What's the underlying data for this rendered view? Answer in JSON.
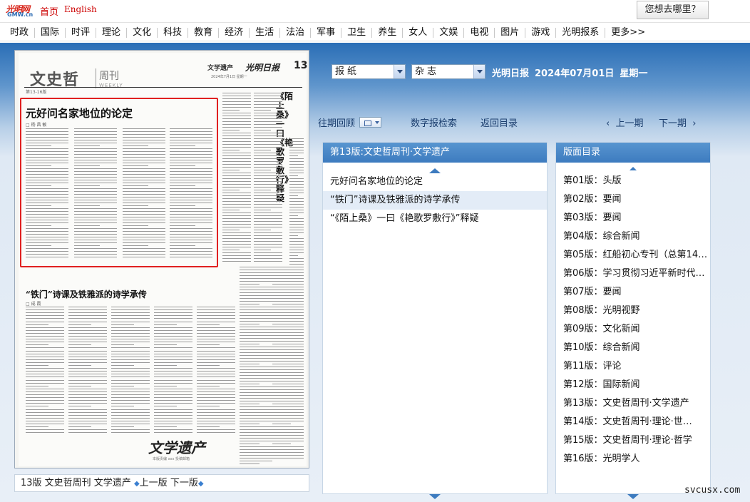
{
  "topbar": {
    "logo_cn": "光明网",
    "logo_en": "GMW.cn",
    "home": "首页",
    "english": "English",
    "where_button": "您想去哪里？"
  },
  "nav": [
    "时政",
    "国际",
    "时评",
    "理论",
    "文化",
    "科技",
    "教育",
    "经济",
    "生活",
    "法治",
    "军事",
    "卫生",
    "养生",
    "女人",
    "文娱",
    "电视",
    "图片",
    "游戏",
    "光明报系",
    "更多>>"
  ],
  "newspaper": {
    "header_title": "文史哲",
    "header_weekly": "周刊",
    "header_weekly_en": "WEEKLY",
    "section": "文学遗产",
    "brand": "光明日报",
    "page_number": "13",
    "date_line": "2024年7月1日 星期一",
    "page_range": "第13-16版",
    "article1_title": "元好问名家地位的论定",
    "article1_author": "□ 杨 昌 敏",
    "article2_title": "“铁门”诗课及铁雅派的诗学承传",
    "article2_author": "□ 成 霞",
    "article3_title": "《陌上桑》一曰《艳歌罗敷行》释疑",
    "stamp": "文学遗产",
    "stamp_sub": "本版责编 xxx 投稿邮箱"
  },
  "caption": {
    "page_label": "13版 文史哲周刊 文学遗产",
    "prev": "上一版",
    "next": "下一版"
  },
  "selectors": {
    "paper": "报纸",
    "magazine": "杂志"
  },
  "issue": {
    "paper_name": "光明日报",
    "date": "2024年07月01日",
    "weekday": "星期一"
  },
  "toolbar": {
    "past": "往期回顾",
    "search": "数字报检索",
    "back": "返回目录",
    "prev_issue": "上一期",
    "next_issue": "下一期"
  },
  "articles_panel": {
    "title": "第13版:文史哲周刊·文学遗产",
    "items": [
      "元好问名家地位的论定",
      "“铁门”诗课及铁雅派的诗学承传",
      "“《陌上桑》一曰《艳歌罗敷行》”释疑"
    ]
  },
  "index_panel": {
    "title": "版面目录",
    "items": [
      "第01版：头版",
      "第02版：要闻",
      "第03版：要闻",
      "第04版：综合新闻",
      "第05版：红船初心专刊（总第142…",
      "第06版：学习贯彻习近平新时代…",
      "第07版：要闻",
      "第08版：光明视野",
      "第09版：文化新闻",
      "第10版：综合新闻",
      "第11版：评论",
      "第12版：国际新闻",
      "第13版：文史哲周刊·文学遗产",
      "第14版：文史哲周刊·理论·世…",
      "第15版：文史哲周刊·理论·哲学",
      "第16版：光明学人"
    ]
  },
  "watermark": "svcusx.com"
}
